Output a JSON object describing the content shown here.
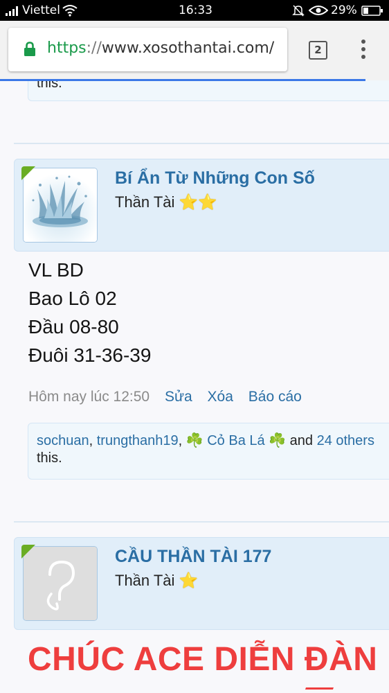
{
  "status_bar": {
    "carrier": "Viettel",
    "time": "16:33",
    "battery": "29%",
    "icons": [
      "signal-icon",
      "wifi-icon",
      "mute-icon",
      "eye-icon",
      "battery-icon"
    ]
  },
  "browser": {
    "url_scheme": "https",
    "url_sep": "://",
    "url_rest": "www.xosothantai.com/",
    "tab_count": "2",
    "icons": [
      "lock-icon",
      "tabs-icon",
      "menu-icon"
    ],
    "colors": {
      "lock": "#1a9a4a",
      "progress": "#3b78e7"
    }
  },
  "prev_post": {
    "likes_tail": "this."
  },
  "post1": {
    "username": "Bí Ẩn Từ Những Con Số",
    "user_title": "Thần Tài",
    "stars": "⭐⭐",
    "lines": [
      "VL BD",
      "Bao Lô 02",
      "Đầu 08-80",
      "Đuôi 31-36-39"
    ],
    "time": "Hôm nay lúc 12:50",
    "actions": {
      "edit": "Sửa",
      "delete": "Xóa",
      "report": "Báo cáo"
    },
    "likes": {
      "user1": "sochuan",
      "sep1": ", ",
      "user2": "trungthanh19",
      "sep2": ", ",
      "clover": "☘️",
      "user3": "Cỏ Ba Lá",
      "and": " and ",
      "others": "24 others",
      "tail": "this."
    }
  },
  "post2": {
    "username": "CẦU THẦN TÀI 177",
    "user_title": "Thần Tài",
    "stars": "⭐",
    "big_text": "CHÚC ACE DIỄN ĐÀN"
  },
  "colors": {
    "username": "#1d5f8e",
    "link": "#2a6ea4",
    "user_panel": "#e1eef9",
    "headline": "#ee3e3e",
    "online_badge": "#6aad24"
  }
}
